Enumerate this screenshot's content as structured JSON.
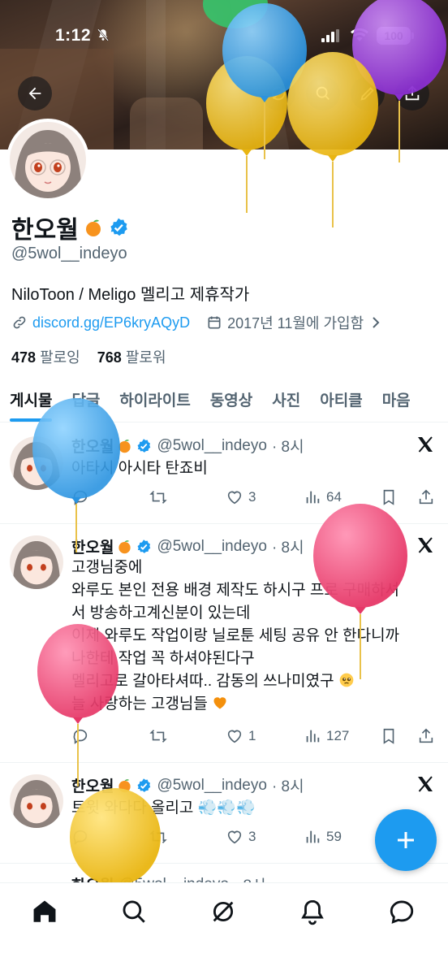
{
  "status_bar": {
    "time": "1:12",
    "battery": "100"
  },
  "profile": {
    "name": "한오월",
    "handle": "@5wol__indeyo",
    "bio": "NiloToon / Meligo 멜리고 제휴작가",
    "link": "discord.gg/EP6kryAQyD",
    "joined": "2017년 11월에 가입함",
    "following_count": "478",
    "following_label": "팔로잉",
    "followers_count": "768",
    "followers_label": "팔로워"
  },
  "tabs": [
    "게시물",
    "답글",
    "하이라이트",
    "동영상",
    "사진",
    "아티클",
    "마음"
  ],
  "tweets": [
    {
      "name": "한오월",
      "handle": "@5wol__indeyo",
      "time": "· 8시",
      "text": "아타시 아시타 탄죠비",
      "replies": "",
      "retweets": "",
      "likes": "3",
      "views": "64"
    },
    {
      "name": "한오월",
      "handle": "@5wol__indeyo",
      "time": "· 8시",
      "lines": [
        "고갱님중에",
        "와루도 본인 전용 배경 제작도 하시구 프로 구매하셔",
        "서 방송하고계신분이 있는데",
        "이제 와루도 작업이랑 닐로툰 세팅 공유 안 한다니까",
        "나한테 작업 꼭 하셔야된다구",
        "멜리고로 갈아타셔따.. 감동의 쓰나미였구",
        "늘 사랑하는 고갱님들"
      ],
      "replies": "",
      "retweets": "",
      "likes": "1",
      "views": "127"
    },
    {
      "name": "한오월",
      "handle": "@5wol__indeyo",
      "time": "· 8시",
      "text": "트윗 와다다 올리고",
      "replies": "",
      "retweets": "",
      "likes": "3",
      "views": "59"
    }
  ],
  "fourth_tweet_partial": {
    "name": "한오월",
    "handle": "@5wol__indeyo",
    "time": "· 8시"
  },
  "colors": {
    "accent": "#1d9bf0",
    "text": "#0f1419",
    "secondary": "#536471",
    "balloon_purple": "#9b3fd6",
    "balloon_yellow": "#f2c21a",
    "balloon_blue": "#3aa8ef",
    "balloon_pink": "#ee4a7a"
  },
  "icons": [
    "back-arrow-icon",
    "compass-icon",
    "search-icon",
    "edit-pencil-icon",
    "share-icon",
    "link-icon",
    "calendar-icon",
    "chevron-right-icon",
    "verified-badge-icon",
    "x-logo-icon",
    "reply-icon",
    "retweet-icon",
    "heart-icon",
    "views-icon",
    "bookmark-icon",
    "compose-plus-icon",
    "home-icon",
    "grok-icon",
    "bell-icon",
    "chat-icon"
  ]
}
